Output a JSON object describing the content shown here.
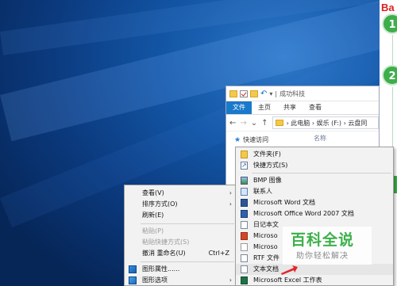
{
  "brand": {
    "text": "Ba"
  },
  "steps": [
    "1",
    "2"
  ],
  "explorer": {
    "title": "成功科技",
    "ribbon_tabs": [
      "文件",
      "主页",
      "共享",
      "查看"
    ],
    "address_path": "› 此电脑 › 娱乐 (F:) › 云盘同",
    "nav_item": "快速访问",
    "column_header": "名称"
  },
  "context_menu": {
    "items": [
      {
        "label": "查看(V)",
        "arrow": "›"
      },
      {
        "label": "排序方式(O)",
        "arrow": "›"
      },
      {
        "label": "刷新(E)"
      },
      {
        "label": "粘贴(P)"
      },
      {
        "label": "粘贴快捷方式(S)"
      },
      {
        "label": "撤消 重命名(U)",
        "shortcut": "Ctrl+Z"
      },
      {
        "label": "图形属性......"
      },
      {
        "label": "图形选项",
        "arrow": "›"
      }
    ]
  },
  "new_submenu": {
    "items": [
      {
        "label": "文件夹(F)",
        "icon": "folder-icon"
      },
      {
        "label": "快捷方式(S)",
        "icon": "shortcut-icon"
      },
      {
        "label": "BMP 图像",
        "icon": "bmp-image-icon"
      },
      {
        "label": "联系人",
        "icon": "contact-icon"
      },
      {
        "label": "Microsoft Word 文档",
        "icon": "word-doc-icon"
      },
      {
        "label": "Microsoft Office Word 2007 文档",
        "icon": "word-2007-doc-icon"
      },
      {
        "label": "日记本文",
        "icon": "journal-icon"
      },
      {
        "label": "Microso",
        "icon": "powerpoint-icon"
      },
      {
        "label": "Microso",
        "icon": "publisher-icon"
      },
      {
        "label": "RTF 文件",
        "icon": "rtf-icon"
      },
      {
        "label": "文本文档",
        "icon": "text-doc-icon"
      },
      {
        "label": "Microsoft Excel 工作表",
        "icon": "excel-icon"
      }
    ]
  },
  "watermark": {
    "title": "百科全说",
    "subtitle": "助你轻松解决"
  },
  "colors": {
    "accent": "#1979ca",
    "brand_green": "#3cb04a",
    "arrow_red": "#e0262b"
  }
}
